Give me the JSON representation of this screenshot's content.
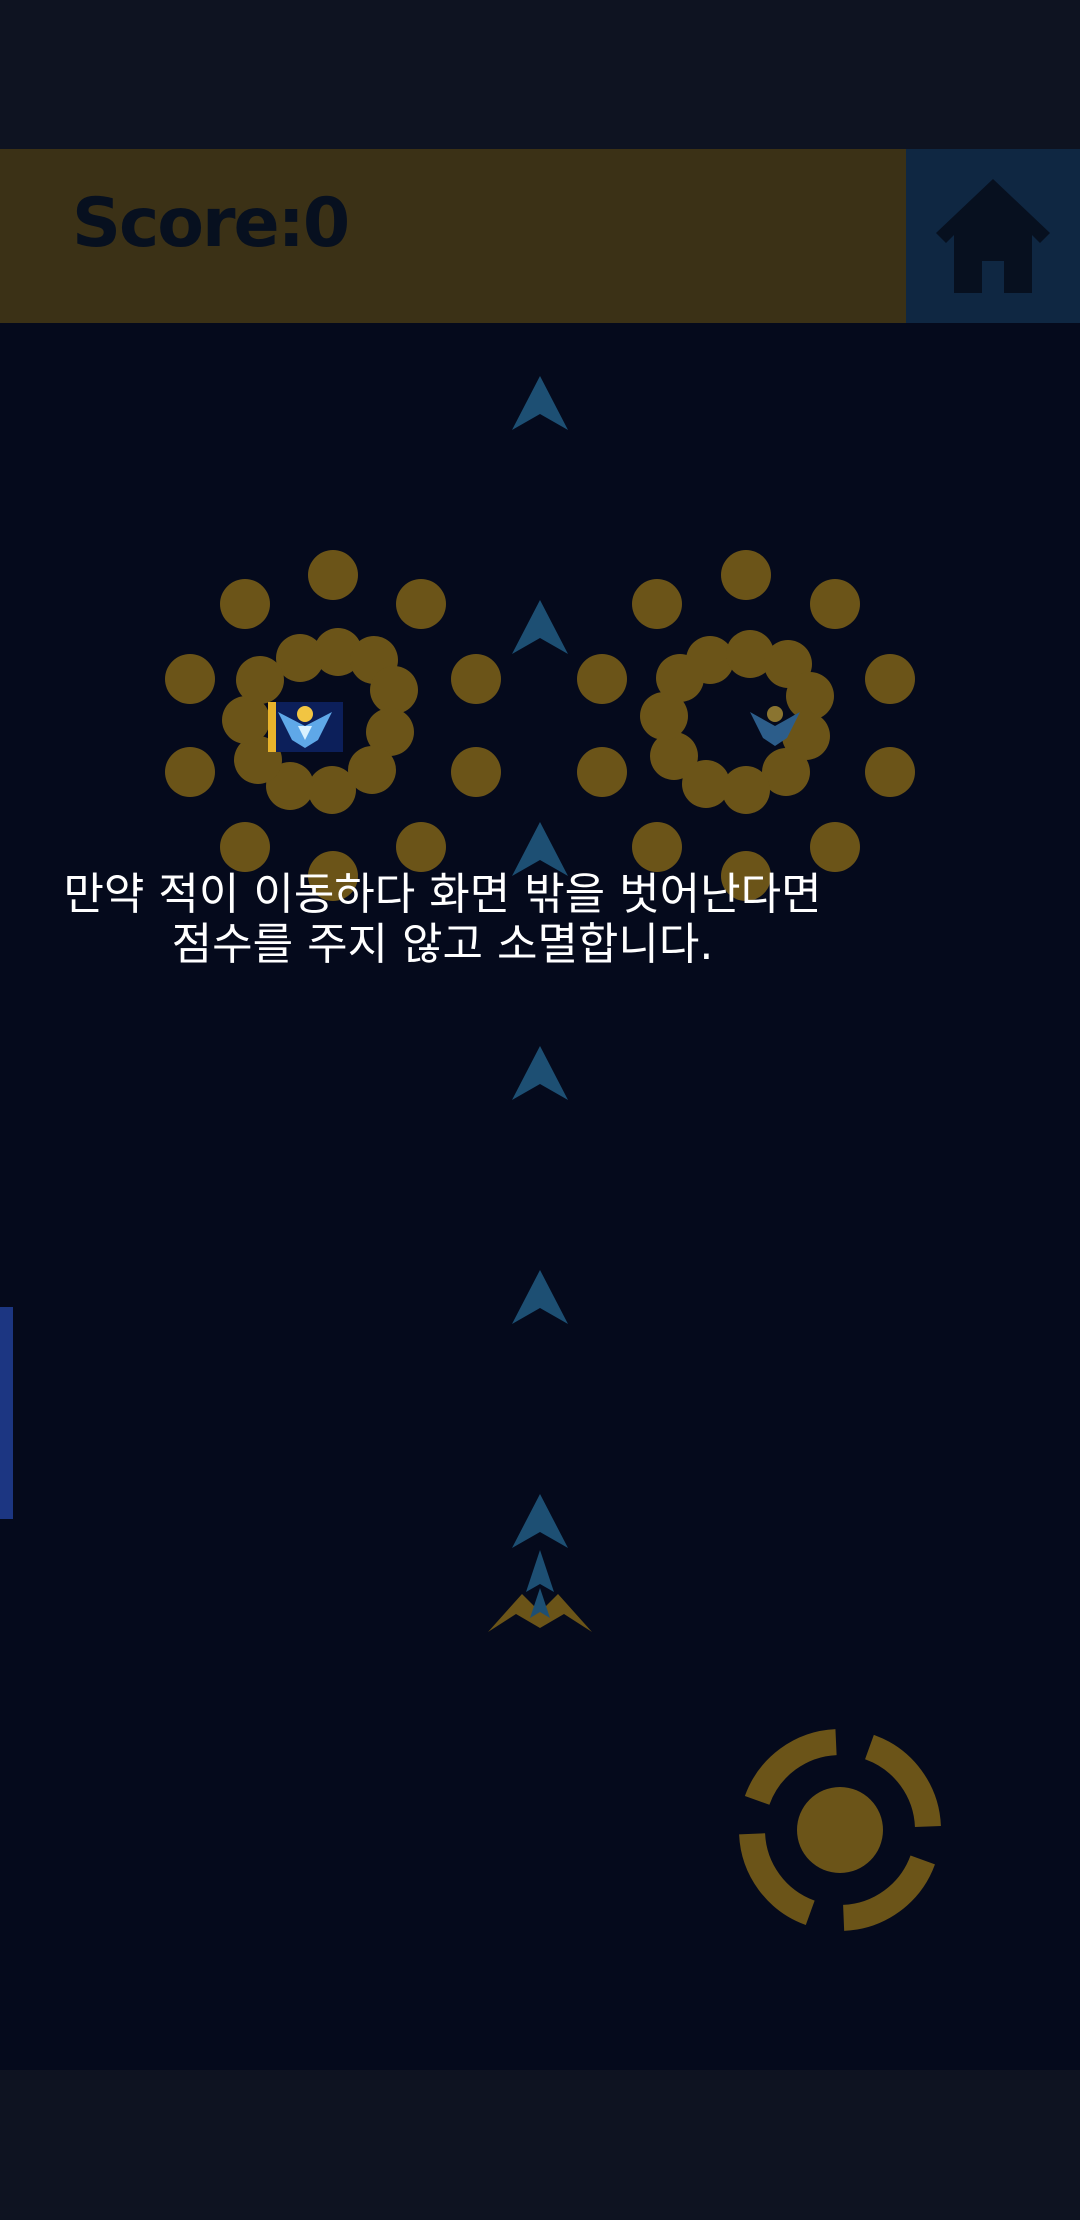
{
  "hud": {
    "score_label": "Score:",
    "score_value": "0",
    "score_display": "Score:0",
    "home_icon": "home-icon"
  },
  "tutorial": {
    "line1": "만약 적이 이동하다 화면 밖을 벗어난다면",
    "line2": "점수를 주지 않고 소멸합니다."
  },
  "controls": {
    "fire_icon": "crosshair-fire-icon"
  },
  "colors": {
    "background": "#050a1c",
    "system_bar": "#0e1321",
    "score_panel": "#3b3116",
    "home_panel": "#0f2742",
    "gold": "#6b5418",
    "arrow": "#1d4f73",
    "side_gauge": "#1c3682"
  }
}
